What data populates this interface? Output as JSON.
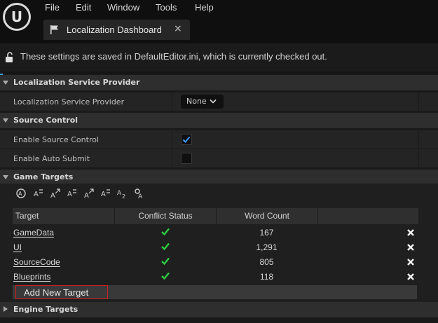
{
  "menu": [
    "File",
    "Edit",
    "Window",
    "Tools",
    "Help"
  ],
  "tab": {
    "title": "Localization Dashboard",
    "close": "×"
  },
  "info": {
    "text": "These settings are saved in DefaultEditor.ini, which is currently checked out."
  },
  "sections": {
    "provider": {
      "title": "Localization Service Provider",
      "prop_label": "Localization Service Provider",
      "dropdown_value": "None"
    },
    "source_control": {
      "title": "Source Control",
      "enable_label": "Enable Source Control",
      "enable_checked": true,
      "auto_submit_label": "Enable Auto Submit",
      "auto_submit_checked": false
    },
    "game_targets": {
      "title": "Game Targets",
      "columns": [
        "Target",
        "Conflict Status",
        "Word Count"
      ],
      "rows": [
        {
          "target": "GameData",
          "status": "ok",
          "words": "167"
        },
        {
          "target": "UI",
          "status": "ok",
          "words": "1,291"
        },
        {
          "target": "SourceCode",
          "status": "ok",
          "words": "805"
        },
        {
          "target": "Blueprints",
          "status": "ok",
          "words": "118"
        }
      ],
      "add_button": "Add New Target"
    },
    "engine_targets": {
      "title": "Engine Targets"
    }
  },
  "colors": {
    "check_green": "#2ecc40",
    "accent_blue": "#3d9bff",
    "add_border": "#cc2020"
  }
}
